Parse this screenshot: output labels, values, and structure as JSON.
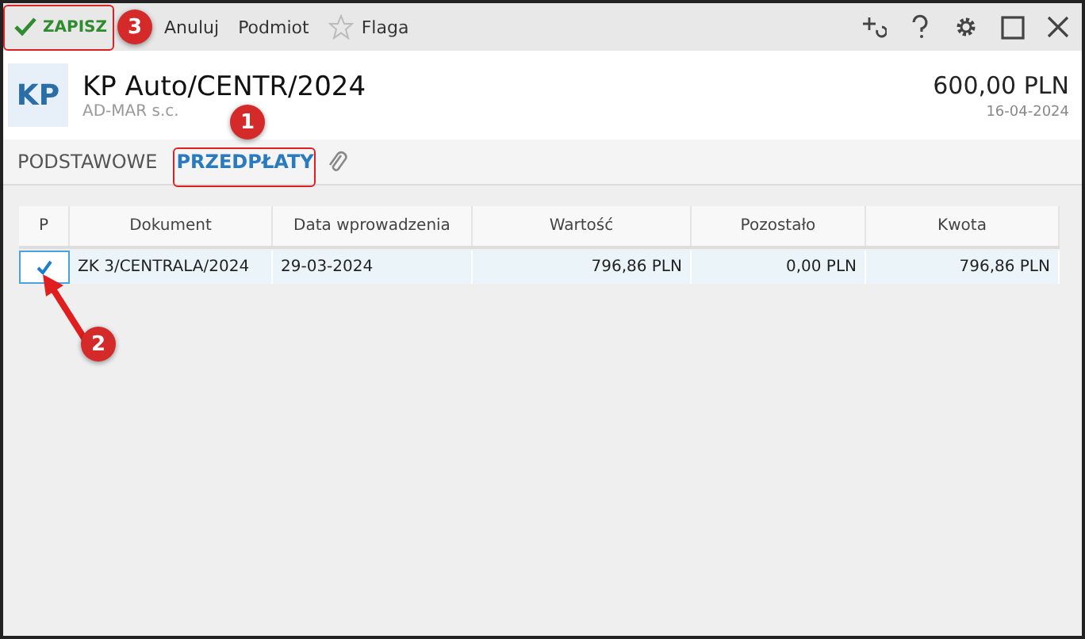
{
  "toolbar": {
    "save": "ZAPISZ",
    "cancel": "Anuluj",
    "subject": "Podmiot",
    "flag": "Flaga"
  },
  "header": {
    "badge": "KP",
    "title": "KP Auto/CENTR/2024",
    "subtitle": "AD-MAR s.c.",
    "amount": "600,00 PLN",
    "date": "16-04-2024"
  },
  "tabs": [
    {
      "label": "PODSTAWOWE",
      "selected": false
    },
    {
      "label": "PRZEDPŁATY",
      "selected": true
    }
  ],
  "table": {
    "columns": [
      "P",
      "Dokument",
      "Data wprowadzenia",
      "Wartość",
      "Pozostało",
      "Kwota"
    ],
    "rows": [
      {
        "cells": [
          {
            "kind": "checkbox",
            "checked": true
          },
          {
            "kind": "text",
            "text": "ZK 3/CENTRALA/2024"
          },
          {
            "kind": "text",
            "text": "29-03-2024"
          },
          {
            "kind": "text",
            "text": "796,86 PLN"
          },
          {
            "kind": "text",
            "text": "0,00 PLN"
          },
          {
            "kind": "text",
            "text": "796,86 PLN"
          }
        ]
      }
    ]
  },
  "annotations": [
    "1",
    "2",
    "3"
  ]
}
